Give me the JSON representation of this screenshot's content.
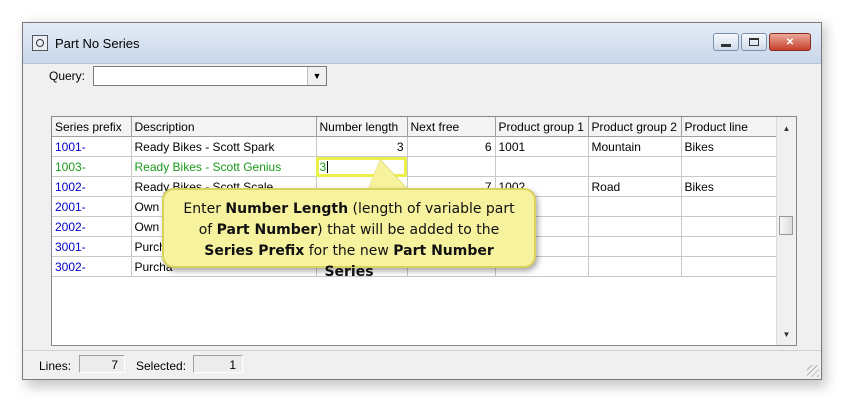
{
  "window": {
    "title": "Part No Series",
    "buttons": {
      "minimize": "",
      "maximize": "",
      "close": "✕"
    }
  },
  "query": {
    "label": "Query:",
    "value": ""
  },
  "table": {
    "columns": [
      "Series prefix",
      "Description",
      "Number length",
      "Next free",
      "Product group 1",
      "Product group 2",
      "Product line"
    ],
    "rows": [
      {
        "prefix": "1001-",
        "description": "Ready Bikes - Scott Spark",
        "number_length": "3",
        "next_free": "6",
        "pg1": "1001",
        "pg2": "Mountain",
        "line": "Bikes"
      },
      {
        "prefix": "1003-",
        "description": "Ready Bikes - Scott Genius",
        "number_length": "3",
        "next_free": "",
        "pg1": "",
        "pg2": "",
        "line": ""
      },
      {
        "prefix": "1002-",
        "description": "Ready Bikes - Scott Scale",
        "number_length": "",
        "next_free": "7",
        "pg1": "1002",
        "pg2": "Road",
        "line": "Bikes"
      },
      {
        "prefix": "2001-",
        "description": "Own C",
        "number_length": "",
        "next_free": "",
        "pg1": "",
        "pg2": "",
        "line": ""
      },
      {
        "prefix": "2002-",
        "description": "Own C",
        "number_length": "",
        "next_free": "",
        "pg1": "",
        "pg2": "",
        "line": ""
      },
      {
        "prefix": "3001-",
        "description": "Purcha",
        "number_length": "",
        "next_free": "",
        "pg1": "",
        "pg2": "",
        "line": ""
      },
      {
        "prefix": "3002-",
        "description": "Purcha",
        "number_length": "",
        "next_free": "",
        "pg1": "",
        "pg2": "",
        "line": ""
      }
    ]
  },
  "callout": {
    "t1": "Enter ",
    "b1": "Number Length",
    "t2": " (length of variable part of ",
    "b2": "Part Number",
    "t3": ") that will be added to the ",
    "b3": "Series Prefix",
    "t4": " for the new ",
    "b4": "Part Number Series"
  },
  "status": {
    "lines_label": "Lines:",
    "lines_value": "7",
    "selected_label": "Selected:",
    "selected_value": "1"
  },
  "colors": {
    "prefix_link": "#0000c8",
    "selected_row": "#1a9a1a",
    "callout_bg": "#f7f29e",
    "edit_highlight": "#e9f04a"
  },
  "icons": {
    "app": "part-series-app-icon",
    "scroll_up": "scroll-up-icon",
    "scroll_down": "scroll-down-icon"
  }
}
